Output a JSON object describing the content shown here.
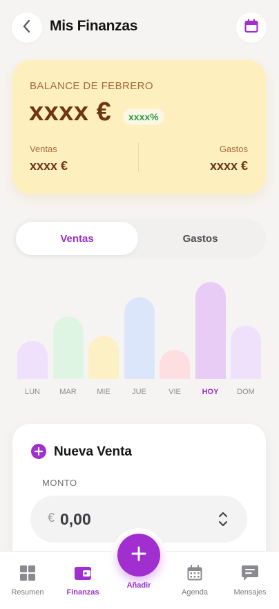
{
  "header": {
    "title": "Mis Finanzas",
    "back_icon": "chevron-left-icon",
    "calendar_icon": "calendar-icon"
  },
  "balance": {
    "label": "BALANCE DE FEBRERO",
    "amount": "xxxx €",
    "change_pct": "xxxx%",
    "sales_label": "Ventas",
    "sales_value": "xxxx €",
    "expenses_label": "Gastos",
    "expenses_value": "xxxx €"
  },
  "tabs": {
    "sales": "Ventas",
    "expenses": "Gastos",
    "selected": "Ventas"
  },
  "chart_data": {
    "type": "bar",
    "categories": [
      "LUN",
      "MAR",
      "MIE",
      "JUE",
      "VIE",
      "HOY",
      "DOM"
    ],
    "values": [
      55,
      90,
      62,
      118,
      42,
      140,
      77
    ],
    "colors": [
      "#efe1fb",
      "#dff5e3",
      "#fdf0c4",
      "#dce6fb",
      "#fddfe1",
      "#e9ccf5",
      "#efe1fb"
    ],
    "highlighted": "HOY"
  },
  "new_sale": {
    "title": "Nueva Venta",
    "amount_label": "MONTO",
    "currency": "€",
    "amount_value": "0,00"
  },
  "bottom_nav": {
    "items": [
      {
        "label": "Resumen",
        "icon": "grid-icon"
      },
      {
        "label": "Finanzas",
        "icon": "wallet-icon"
      },
      {
        "label": "Agenda",
        "icon": "calendar-icon"
      },
      {
        "label": "Mensajes",
        "icon": "chat-icon"
      }
    ],
    "fab_label": "Añadir",
    "active": "Finanzas"
  },
  "colors": {
    "accent": "#a12fd0",
    "balance_card": "#feefbf",
    "balance_text": "#6e3613",
    "positive": "#2f9a4d"
  }
}
